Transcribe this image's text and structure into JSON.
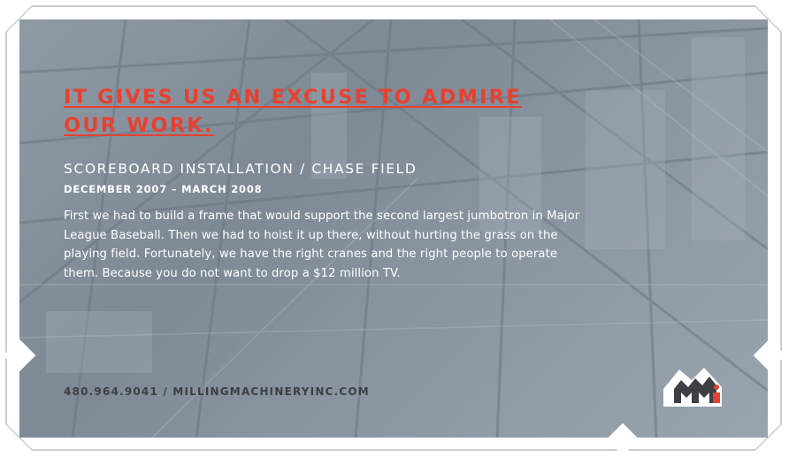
{
  "headline": {
    "line1": "IT GIVES US AN EXCUSE TO ADMIRE",
    "line2": "OUR WORK."
  },
  "subtitle": "SCOREBOARD INSTALLATION / CHASE FIELD",
  "dates": "DECEMBER 2007 – MARCH 2008",
  "body": "First we had to build a frame that would support the second largest jumbotron in Major League Baseball. Then we had to hoist it up there, without hurting the grass on the playing field. Fortunately, we have the right cranes and the right people to operate them. Because you do not want to drop a $12 million TV.",
  "contact": "480.964.9041 / MILLINGMACHINERYINC.COM",
  "logo": {
    "text": "MMi",
    "icon": "mmi-logo-icon"
  },
  "colors": {
    "accent": "#e8402f",
    "panel": "#8a95a1",
    "footer_text": "#3d3f44"
  }
}
